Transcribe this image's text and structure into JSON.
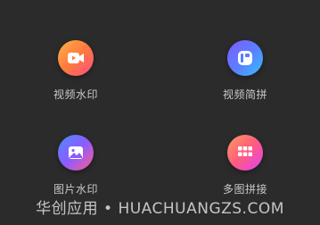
{
  "tiles": [
    {
      "label": "视频水印",
      "icon": "video-camera-icon"
    },
    {
      "label": "视频简拼",
      "icon": "video-trim-icon"
    },
    {
      "label": "图片水印",
      "icon": "image-icon"
    },
    {
      "label": "多图拼接",
      "icon": "grid-icon"
    }
  ],
  "watermark": {
    "text": "华创应用 • HUACHUANGZS.COM"
  }
}
